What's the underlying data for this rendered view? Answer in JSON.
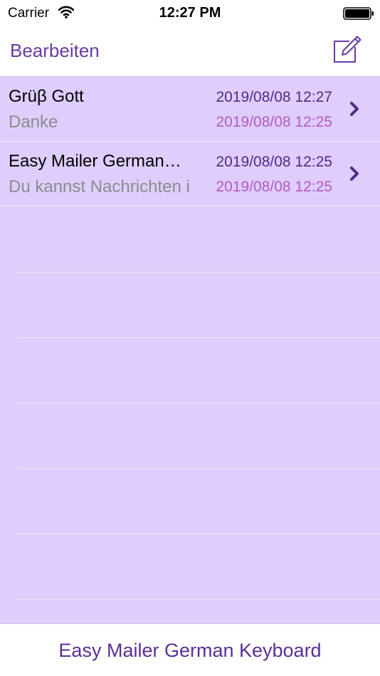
{
  "status_bar": {
    "carrier": "Carrier",
    "time": "12:27 PM",
    "wifi_icon": "wifi-icon",
    "battery_icon": "battery-icon"
  },
  "nav_bar": {
    "edit_label": "Bearbeiten",
    "compose_icon": "compose-icon"
  },
  "messages": [
    {
      "title": "Grüβ Gott",
      "subtitle": "Danke",
      "date_primary": "2019/08/08 12:27",
      "date_secondary": "2019/08/08 12:25"
    },
    {
      "title": "Easy Mailer German…",
      "subtitle": "Du kannst Nachrichten i",
      "date_primary": "2019/08/08 12:25",
      "date_secondary": "2019/08/08 12:25"
    }
  ],
  "toolbar": {
    "keyboard_label": "Easy Mailer German Keyboard"
  },
  "colors": {
    "accent": "#6a3aa3",
    "list_background": "#decdfd",
    "date_primary": "#4d2e86",
    "date_secondary": "#b25cc0"
  }
}
